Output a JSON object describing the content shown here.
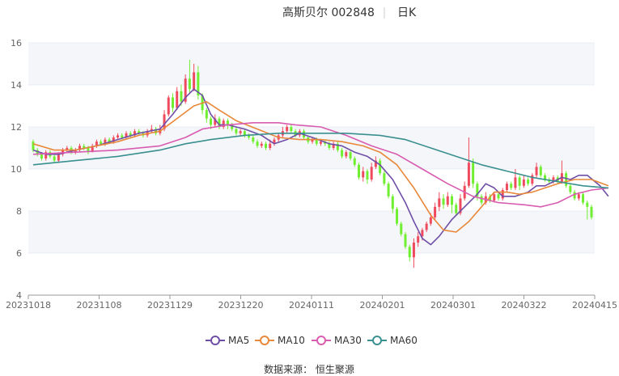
{
  "header": {
    "stock": "高斯贝尔 002848",
    "period": "日K"
  },
  "source": "数据来源： 恒生聚源",
  "colors": {
    "up": "#ef4b5f",
    "down": "#6fef2f",
    "ma5": "#6f4fa6",
    "ma10": "#e8883a",
    "ma30": "#d85cb0",
    "ma60": "#3a8f8f",
    "grid": "#e8ecf3",
    "band": "#f4f6fa"
  },
  "chart_data": {
    "type": "candlestick",
    "ylim": [
      4,
      16
    ],
    "yticks": [
      4,
      6,
      8,
      10,
      12,
      14,
      16
    ],
    "xticks": [
      "20231018",
      "20231108",
      "20231129",
      "20231220",
      "20240111",
      "20240201",
      "20240301",
      "20240322",
      "20240415"
    ],
    "legend": [
      "MA5",
      "MA10",
      "MA30",
      "MA60"
    ],
    "legend_position": "bottom",
    "ma": {
      "MA5": [
        [
          0,
          10.9
        ],
        [
          3,
          10.7
        ],
        [
          6,
          10.7
        ],
        [
          10,
          10.9
        ],
        [
          15,
          11.1
        ],
        [
          20,
          11.4
        ],
        [
          25,
          11.7
        ],
        [
          30,
          11.9
        ],
        [
          33,
          12.6
        ],
        [
          36,
          13.4
        ],
        [
          38,
          13.8
        ],
        [
          40,
          13.5
        ],
        [
          42,
          12.6
        ],
        [
          44,
          12.1
        ],
        [
          46,
          12.1
        ],
        [
          50,
          11.9
        ],
        [
          54,
          11.6
        ],
        [
          57,
          11.2
        ],
        [
          60,
          11.4
        ],
        [
          63,
          11.7
        ],
        [
          66,
          11.5
        ],
        [
          70,
          11.2
        ],
        [
          73,
          11.1
        ],
        [
          76,
          10.8
        ],
        [
          79,
          10.6
        ],
        [
          82,
          10.2
        ],
        [
          85,
          9.5
        ],
        [
          88,
          8.4
        ],
        [
          90,
          7.5
        ],
        [
          92,
          6.7
        ],
        [
          94,
          6.4
        ],
        [
          96,
          6.8
        ],
        [
          99,
          7.6
        ],
        [
          102,
          8.2
        ],
        [
          105,
          8.8
        ],
        [
          107,
          9.3
        ],
        [
          109,
          9.1
        ],
        [
          111,
          8.7
        ],
        [
          114,
          8.7
        ],
        [
          117,
          8.9
        ],
        [
          119,
          9.2
        ],
        [
          121,
          9.2
        ],
        [
          123,
          9.4
        ],
        [
          125,
          9.6
        ],
        [
          127,
          9.5
        ],
        [
          129,
          9.7
        ],
        [
          131,
          9.7
        ],
        [
          134,
          9.2
        ],
        [
          136,
          8.7
        ]
      ],
      "MA10": [
        [
          0,
          11.2
        ],
        [
          5,
          10.9
        ],
        [
          10,
          10.9
        ],
        [
          15,
          11.1
        ],
        [
          20,
          11.3
        ],
        [
          25,
          11.6
        ],
        [
          30,
          11.8
        ],
        [
          34,
          12.4
        ],
        [
          38,
          13.0
        ],
        [
          41,
          13.2
        ],
        [
          44,
          12.8
        ],
        [
          48,
          12.3
        ],
        [
          53,
          11.9
        ],
        [
          58,
          11.5
        ],
        [
          63,
          11.4
        ],
        [
          68,
          11.4
        ],
        [
          73,
          11.3
        ],
        [
          78,
          11.1
        ],
        [
          82,
          10.8
        ],
        [
          86,
          10.2
        ],
        [
          90,
          9.1
        ],
        [
          94,
          7.8
        ],
        [
          97,
          7.1
        ],
        [
          100,
          7.0
        ],
        [
          103,
          7.5
        ],
        [
          106,
          8.2
        ],
        [
          109,
          8.9
        ],
        [
          112,
          8.9
        ],
        [
          115,
          8.8
        ],
        [
          118,
          8.9
        ],
        [
          121,
          9.1
        ],
        [
          124,
          9.3
        ],
        [
          128,
          9.5
        ],
        [
          132,
          9.5
        ],
        [
          136,
          9.2
        ]
      ],
      "MA30": [
        [
          0,
          10.7
        ],
        [
          10,
          10.8
        ],
        [
          20,
          10.9
        ],
        [
          30,
          11.1
        ],
        [
          36,
          11.5
        ],
        [
          40,
          11.9
        ],
        [
          46,
          12.1
        ],
        [
          52,
          12.2
        ],
        [
          58,
          12.2
        ],
        [
          62,
          12.1
        ],
        [
          68,
          12.0
        ],
        [
          74,
          11.6
        ],
        [
          80,
          11.1
        ],
        [
          86,
          10.7
        ],
        [
          92,
          10.0
        ],
        [
          98,
          9.3
        ],
        [
          104,
          8.7
        ],
        [
          110,
          8.4
        ],
        [
          116,
          8.3
        ],
        [
          120,
          8.2
        ],
        [
          124,
          8.4
        ],
        [
          128,
          8.8
        ],
        [
          132,
          9.0
        ],
        [
          136,
          9.1
        ]
      ],
      "MA60": [
        [
          0,
          10.2
        ],
        [
          10,
          10.4
        ],
        [
          20,
          10.6
        ],
        [
          30,
          10.9
        ],
        [
          36,
          11.2
        ],
        [
          42,
          11.4
        ],
        [
          50,
          11.6
        ],
        [
          58,
          11.7
        ],
        [
          66,
          11.7
        ],
        [
          74,
          11.7
        ],
        [
          82,
          11.6
        ],
        [
          88,
          11.4
        ],
        [
          94,
          11.0
        ],
        [
          100,
          10.6
        ],
        [
          106,
          10.2
        ],
        [
          112,
          9.9
        ],
        [
          118,
          9.6
        ],
        [
          124,
          9.4
        ],
        [
          130,
          9.2
        ],
        [
          136,
          9.1
        ]
      ]
    },
    "candles": [
      [
        11.3,
        10.9,
        11.4,
        10.8
      ],
      [
        10.9,
        10.7,
        11.0,
        10.6
      ],
      [
        10.7,
        10.5,
        10.8,
        10.4
      ],
      [
        10.5,
        10.8,
        10.9,
        10.4
      ],
      [
        10.8,
        10.6,
        10.9,
        10.5
      ],
      [
        10.6,
        10.4,
        10.7,
        10.3
      ],
      [
        10.4,
        10.7,
        10.8,
        10.3
      ],
      [
        10.7,
        10.9,
        11.0,
        10.6
      ],
      [
        10.9,
        11.0,
        11.1,
        10.8
      ],
      [
        11.0,
        10.8,
        11.1,
        10.7
      ],
      [
        10.8,
        10.9,
        11.0,
        10.7
      ],
      [
        10.9,
        11.1,
        11.2,
        10.8
      ],
      [
        11.1,
        11.0,
        11.2,
        10.9
      ],
      [
        11.0,
        10.8,
        11.1,
        10.7
      ],
      [
        10.8,
        11.1,
        11.2,
        10.8
      ],
      [
        11.1,
        11.3,
        11.4,
        11.0
      ],
      [
        11.3,
        11.2,
        11.4,
        11.1
      ],
      [
        11.2,
        11.4,
        11.5,
        11.1
      ],
      [
        11.4,
        11.3,
        11.5,
        11.2
      ],
      [
        11.3,
        11.5,
        11.6,
        11.2
      ],
      [
        11.5,
        11.6,
        11.7,
        11.4
      ],
      [
        11.6,
        11.5,
        11.7,
        11.4
      ],
      [
        11.5,
        11.7,
        11.8,
        11.4
      ],
      [
        11.7,
        11.6,
        11.8,
        11.5
      ],
      [
        11.6,
        11.8,
        11.9,
        11.5
      ],
      [
        11.8,
        11.7,
        11.9,
        11.6
      ],
      [
        11.7,
        11.6,
        11.8,
        11.5
      ],
      [
        11.6,
        11.8,
        11.9,
        11.5
      ],
      [
        11.8,
        11.9,
        12.1,
        11.7
      ],
      [
        11.9,
        11.7,
        12.0,
        11.6
      ],
      [
        11.7,
        11.9,
        12.1,
        11.6
      ],
      [
        11.9,
        12.6,
        12.8,
        11.8
      ],
      [
        12.6,
        13.4,
        13.5,
        12.5
      ],
      [
        13.4,
        12.9,
        13.6,
        12.7
      ],
      [
        12.9,
        13.7,
        13.9,
        12.8
      ],
      [
        13.7,
        13.2,
        14.0,
        13.0
      ],
      [
        13.2,
        14.3,
        14.5,
        13.1
      ],
      [
        14.3,
        13.8,
        15.2,
        13.6
      ],
      [
        13.8,
        14.6,
        15.0,
        13.7
      ],
      [
        14.6,
        13.5,
        14.9,
        13.3
      ],
      [
        13.5,
        12.8,
        13.6,
        12.6
      ],
      [
        12.8,
        12.4,
        12.9,
        12.2
      ],
      [
        12.4,
        12.1,
        12.5,
        11.9
      ],
      [
        12.1,
        12.4,
        12.6,
        12.0
      ],
      [
        12.4,
        12.0,
        12.5,
        11.9
      ],
      [
        12.0,
        12.3,
        12.4,
        11.9
      ],
      [
        12.3,
        12.1,
        12.4,
        11.9
      ],
      [
        12.1,
        11.9,
        12.2,
        11.8
      ],
      [
        11.9,
        11.7,
        12.0,
        11.6
      ],
      [
        11.7,
        11.8,
        11.9,
        11.6
      ],
      [
        11.8,
        11.6,
        11.9,
        11.5
      ],
      [
        11.6,
        11.5,
        11.7,
        11.4
      ],
      [
        11.5,
        11.3,
        11.6,
        11.2
      ],
      [
        11.3,
        11.1,
        11.4,
        11.0
      ],
      [
        11.1,
        11.2,
        11.3,
        11.0
      ],
      [
        11.2,
        11.0,
        11.3,
        10.9
      ],
      [
        11.0,
        11.2,
        11.4,
        10.9
      ],
      [
        11.2,
        11.4,
        11.5,
        11.1
      ],
      [
        11.4,
        11.6,
        11.7,
        11.3
      ],
      [
        11.6,
        11.8,
        12.0,
        11.5
      ],
      [
        11.8,
        12.0,
        12.1,
        11.7
      ],
      [
        12.0,
        11.8,
        12.1,
        11.7
      ],
      [
        11.8,
        11.6,
        11.9,
        11.5
      ],
      [
        11.6,
        11.8,
        11.9,
        11.5
      ],
      [
        11.8,
        11.5,
        11.9,
        11.4
      ],
      [
        11.5,
        11.3,
        11.6,
        11.2
      ],
      [
        11.3,
        11.4,
        11.5,
        11.2
      ],
      [
        11.4,
        11.2,
        11.5,
        11.1
      ],
      [
        11.2,
        11.3,
        11.4,
        11.1
      ],
      [
        11.3,
        11.2,
        11.4,
        11.1
      ],
      [
        11.2,
        11.0,
        11.3,
        10.9
      ],
      [
        11.0,
        11.2,
        11.3,
        10.9
      ],
      [
        11.2,
        10.9,
        11.3,
        10.8
      ],
      [
        10.9,
        10.6,
        11.0,
        10.5
      ],
      [
        10.6,
        10.8,
        10.9,
        10.5
      ],
      [
        10.8,
        10.5,
        10.9,
        10.4
      ],
      [
        10.5,
        10.2,
        10.6,
        10.1
      ],
      [
        10.2,
        9.6,
        10.3,
        9.5
      ],
      [
        9.6,
        9.9,
        10.1,
        9.4
      ],
      [
        9.9,
        9.5,
        10.0,
        9.3
      ],
      [
        9.5,
        10.1,
        10.3,
        9.4
      ],
      [
        10.1,
        10.4,
        10.6,
        10.0
      ],
      [
        10.4,
        9.8,
        10.5,
        9.7
      ],
      [
        9.8,
        9.3,
        9.9,
        9.2
      ],
      [
        9.3,
        8.7,
        9.4,
        8.6
      ],
      [
        8.7,
        8.1,
        8.8,
        7.9
      ],
      [
        8.1,
        7.4,
        8.2,
        7.3
      ],
      [
        7.4,
        6.9,
        7.5,
        6.8
      ],
      [
        6.9,
        6.3,
        7.0,
        6.2
      ],
      [
        6.3,
        5.8,
        6.4,
        5.6
      ],
      [
        5.8,
        6.5,
        6.7,
        5.3
      ],
      [
        6.5,
        6.8,
        7.0,
        6.3
      ],
      [
        6.8,
        7.1,
        7.2,
        6.6
      ],
      [
        7.1,
        7.4,
        7.5,
        7.0
      ],
      [
        7.4,
        7.7,
        7.9,
        7.3
      ],
      [
        7.7,
        8.2,
        8.4,
        7.6
      ],
      [
        8.2,
        8.6,
        8.9,
        8.0
      ],
      [
        8.6,
        8.3,
        8.8,
        8.1
      ],
      [
        8.3,
        8.7,
        8.9,
        8.2
      ],
      [
        8.7,
        8.3,
        8.8,
        7.9
      ],
      [
        8.3,
        7.9,
        8.4,
        7.8
      ],
      [
        7.9,
        8.6,
        8.8,
        7.8
      ],
      [
        8.6,
        9.2,
        9.4,
        8.5
      ],
      [
        9.2,
        10.3,
        11.5,
        9.1
      ],
      [
        10.3,
        9.3,
        10.5,
        9.1
      ],
      [
        9.3,
        8.7,
        9.4,
        8.5
      ],
      [
        8.7,
        8.4,
        8.8,
        8.3
      ],
      [
        8.4,
        8.7,
        8.9,
        8.3
      ],
      [
        8.7,
        8.5,
        8.8,
        8.4
      ],
      [
        8.5,
        8.8,
        8.9,
        8.4
      ],
      [
        8.8,
        8.6,
        8.9,
        8.5
      ],
      [
        8.6,
        9.0,
        9.1,
        8.5
      ],
      [
        9.0,
        9.3,
        9.4,
        8.9
      ],
      [
        9.3,
        9.1,
        9.4,
        9.0
      ],
      [
        9.1,
        9.6,
        10.0,
        9.0
      ],
      [
        9.6,
        9.2,
        9.7,
        9.0
      ],
      [
        9.2,
        9.5,
        9.7,
        9.1
      ],
      [
        9.5,
        9.3,
        9.6,
        9.2
      ],
      [
        9.3,
        9.7,
        9.8,
        9.2
      ],
      [
        9.7,
        10.1,
        10.3,
        9.6
      ],
      [
        10.1,
        9.7,
        10.2,
        9.6
      ],
      [
        9.7,
        9.5,
        9.8,
        9.4
      ],
      [
        9.5,
        9.4,
        9.6,
        9.3
      ],
      [
        9.4,
        9.6,
        9.7,
        9.3
      ],
      [
        9.6,
        9.4,
        9.7,
        9.3
      ],
      [
        9.4,
        9.8,
        10.4,
        9.3
      ],
      [
        9.8,
        9.2,
        9.9,
        9.1
      ],
      [
        9.2,
        8.9,
        9.3,
        8.8
      ],
      [
        8.9,
        8.6,
        9.0,
        8.5
      ],
      [
        8.6,
        8.8,
        8.9,
        8.5
      ],
      [
        8.8,
        8.4,
        8.9,
        8.3
      ],
      [
        8.4,
        8.2,
        8.5,
        7.6
      ],
      [
        8.2,
        7.7,
        8.3,
        7.6
      ]
    ]
  }
}
